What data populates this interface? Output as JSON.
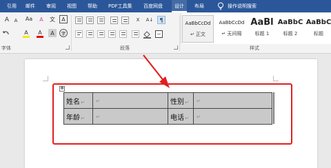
{
  "tabs": [
    "引用",
    "邮件",
    "审阅",
    "视图",
    "帮助",
    "PDF工具集",
    "百度网盘",
    "设计",
    "布局",
    "操作说明搜索"
  ],
  "ribbon": {
    "font_group_label": "字体",
    "paragraph_group_label": "段落",
    "styles_group_label": "样式",
    "font_size_up": "A",
    "font_size_down": "A",
    "change_case": "Aa",
    "clear_format": "A",
    "char_border": "A",
    "phonetic": "文",
    "highlight": "A",
    "font_color": "A",
    "shade": "A",
    "encircle": "字",
    "chinese_layout": "X",
    "sort": "A↓",
    "show_marks": "¶"
  },
  "styles": [
    {
      "sample": "AaBbCcDd",
      "name": "↵ 正文"
    },
    {
      "sample": "AaBbCcDd",
      "name": "↵ 无间隔"
    },
    {
      "sample": "AaBl",
      "name": "标题 1"
    },
    {
      "sample": "AaBbC",
      "name": "标题 2"
    },
    {
      "sample": "AaBbC",
      "name": "标题"
    }
  ],
  "table": {
    "rows": [
      [
        "姓名",
        "",
        "性别",
        ""
      ],
      [
        "年龄",
        "",
        "电话",
        ""
      ]
    ],
    "mark": "↵"
  },
  "colors": {
    "ribbon_tab_bg": "#2b579a",
    "highlight_frame": "#e02020",
    "cell_shading": "#c9c9c9"
  }
}
